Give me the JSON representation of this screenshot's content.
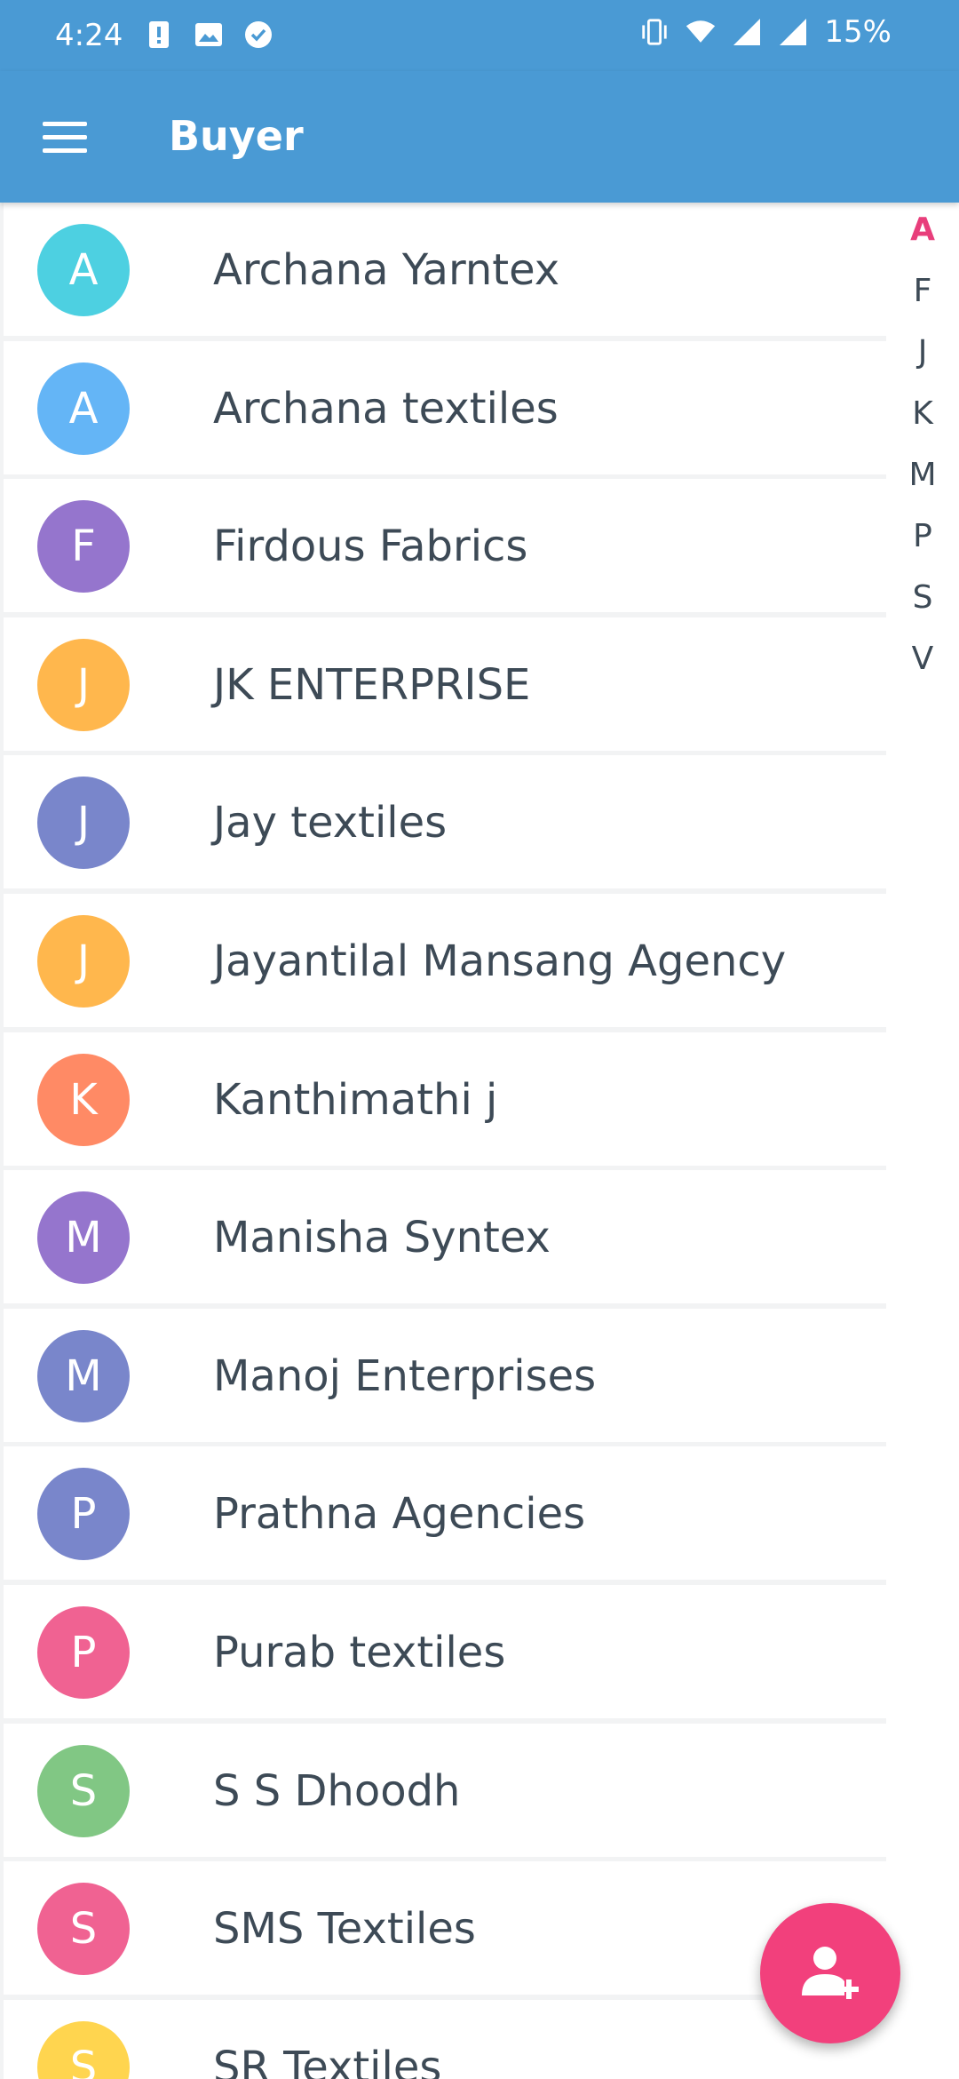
{
  "status_bar": {
    "time": "4:24",
    "battery": "15%",
    "left_icons": [
      "alert-icon",
      "image-icon",
      "check-circle-icon"
    ],
    "right_icons": [
      "vibrate-icon",
      "wifi-icon",
      "signal-icon",
      "signal-icon"
    ]
  },
  "app_bar": {
    "title": "Buyer",
    "menu_icon": "menu-icon",
    "color": "#4a9ad4"
  },
  "buyers": [
    {
      "initial": "A",
      "name": "Archana Yarntex",
      "color": "#4dd0e1"
    },
    {
      "initial": "A",
      "name": "Archana textiles",
      "color": "#64b5f6"
    },
    {
      "initial": "F",
      "name": "Firdous Fabrics",
      "color": "#9575cd"
    },
    {
      "initial": "J",
      "name": "JK ENTERPRISE",
      "color": "#ffb74d"
    },
    {
      "initial": "J",
      "name": "Jay textiles",
      "color": "#7986cb"
    },
    {
      "initial": "J",
      "name": "Jayantilal Mansang Agency",
      "color": "#ffb74d"
    },
    {
      "initial": "K",
      "name": "Kanthimathi j",
      "color": "#ff8a65"
    },
    {
      "initial": "M",
      "name": "Manisha Syntex",
      "color": "#9575cd"
    },
    {
      "initial": "M",
      "name": "Manoj Enterprises",
      "color": "#7986cb"
    },
    {
      "initial": "P",
      "name": "Prathna Agencies",
      "color": "#7986cb"
    },
    {
      "initial": "P",
      "name": "Purab textiles",
      "color": "#f06292"
    },
    {
      "initial": "S",
      "name": "S S Dhoodh",
      "color": "#81c784"
    },
    {
      "initial": "S",
      "name": "SMS Textiles",
      "color": "#f06292"
    },
    {
      "initial": "S",
      "name": "SR Textiles",
      "color": "#ffd54f"
    }
  ],
  "alphabet_index": {
    "letters": [
      "A",
      "F",
      "J",
      "K",
      "M",
      "P",
      "S",
      "V"
    ],
    "active": "A",
    "active_color": "#e83e7b"
  },
  "fab": {
    "icon": "add-person-icon",
    "color": "#f2407c"
  }
}
